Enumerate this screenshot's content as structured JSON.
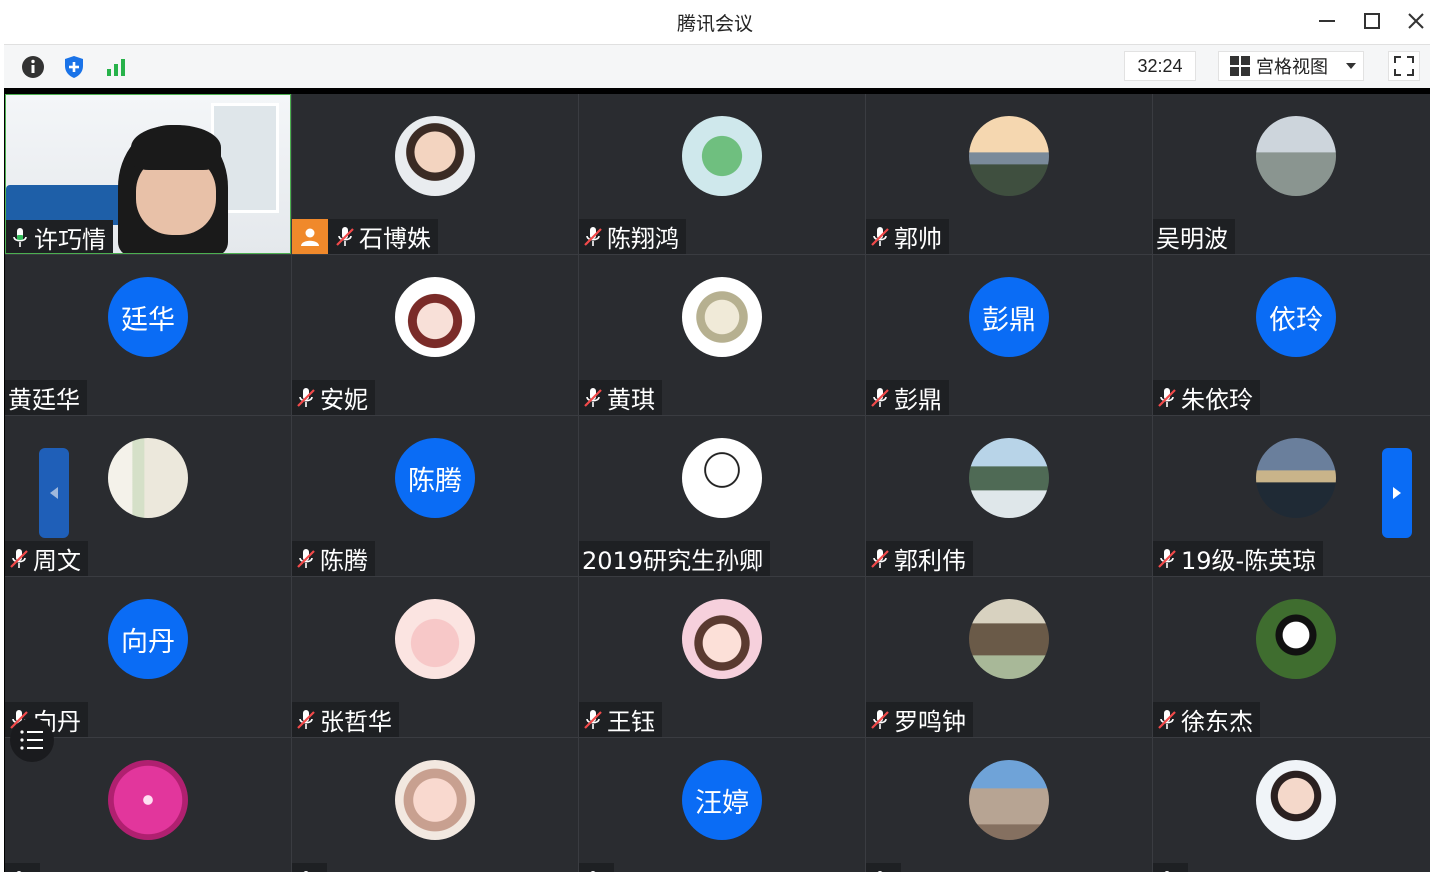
{
  "window": {
    "title": "腾讯会议"
  },
  "toolbar": {
    "timer": "32:24",
    "view_label": "宫格视图"
  },
  "colors": {
    "avatar_blue": "#0a6cf5",
    "tile_bg": "#2a2c30",
    "host_badge": "#f0892b",
    "speaking_mic": "#35c05d"
  },
  "participants": [
    {
      "name": "许巧情",
      "mic": "on",
      "kind": "video"
    },
    {
      "name": "石博姝",
      "mic": "muted",
      "kind": "photo",
      "host": true,
      "photo": "child-photo"
    },
    {
      "name": "陈翔鸿",
      "mic": "muted",
      "kind": "photo",
      "photo": "green-cartoon"
    },
    {
      "name": "郭帅",
      "mic": "muted",
      "kind": "photo",
      "photo": "sunset-landscape"
    },
    {
      "name": "吴明波",
      "mic": "none",
      "kind": "photo",
      "photo": "mountain-person"
    },
    {
      "name": "黄廷华",
      "mic": "none",
      "kind": "text",
      "avatar_text": "廷华"
    },
    {
      "name": "安妮",
      "mic": "muted",
      "kind": "photo",
      "photo": "cartoon-girl"
    },
    {
      "name": "黄琪",
      "mic": "muted",
      "kind": "photo",
      "photo": "anime-character"
    },
    {
      "name": "彭鼎",
      "mic": "muted",
      "kind": "text",
      "avatar_text": "彭鼎"
    },
    {
      "name": "朱依玲",
      "mic": "muted",
      "kind": "text",
      "avatar_text": "依玲"
    },
    {
      "name": "周文",
      "mic": "muted",
      "kind": "photo",
      "photo": "sketch-couple"
    },
    {
      "name": "陈腾",
      "mic": "muted",
      "kind": "text",
      "avatar_text": "陈腾"
    },
    {
      "name": "2019研究生孙卿",
      "mic": "none",
      "kind": "photo",
      "photo": "doodle-figure"
    },
    {
      "name": "郭利伟",
      "mic": "muted",
      "kind": "photo",
      "photo": "misty-mountains"
    },
    {
      "name": "19级-陈英琼",
      "mic": "muted",
      "kind": "photo",
      "photo": "lake-birds"
    },
    {
      "name": "向丹",
      "mic": "muted",
      "kind": "text",
      "avatar_text": "向丹"
    },
    {
      "name": "张哲华",
      "mic": "muted",
      "kind": "photo",
      "photo": "pink-pig"
    },
    {
      "name": "王钰",
      "mic": "muted",
      "kind": "photo",
      "photo": "glasses-girl"
    },
    {
      "name": "罗鸣钟",
      "mic": "muted",
      "kind": "photo",
      "photo": "temple-gate"
    },
    {
      "name": "徐东杰",
      "mic": "muted",
      "kind": "photo",
      "photo": "panda"
    },
    {
      "name": "",
      "mic": "muted",
      "kind": "photo",
      "photo": "pink-flower"
    },
    {
      "name": "",
      "mic": "muted",
      "kind": "photo",
      "photo": "piglet"
    },
    {
      "name": "",
      "mic": "muted",
      "kind": "text",
      "avatar_text": "汪婷"
    },
    {
      "name": "",
      "mic": "muted",
      "kind": "photo",
      "photo": "building"
    },
    {
      "name": "",
      "mic": "muted",
      "kind": "photo",
      "photo": "woman-portrait"
    }
  ]
}
